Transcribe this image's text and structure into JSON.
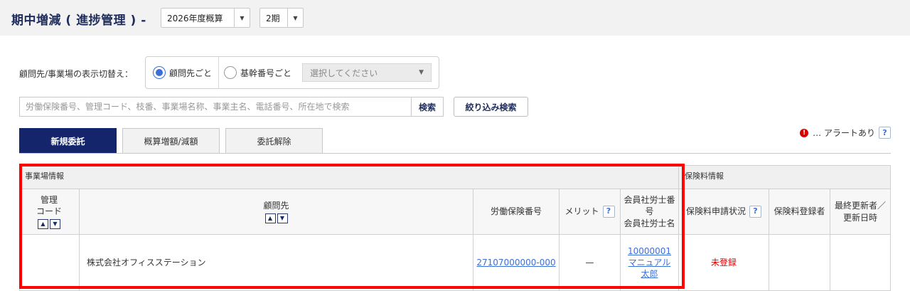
{
  "header": {
    "title": "期中増減 ( 進捗管理 ) -",
    "year_select": "2026年度概算",
    "period_select": "2期"
  },
  "switcher": {
    "label": "顧問先/事業場の表示切替え：",
    "option_client": "顧問先ごと",
    "option_base": "基幹番号ごと",
    "base_placeholder": "選択してください",
    "selected": "顧問先ごと"
  },
  "search": {
    "placeholder": "労働保険番号、管理コード、枝番、事業場名称、事業主名、電話番号、所在地で検索",
    "value": "",
    "button": "検索",
    "filter_button": "絞り込み検索"
  },
  "tabs": [
    {
      "label": "新規委託",
      "active": true
    },
    {
      "label": "概算増額/減額",
      "active": false
    },
    {
      "label": "委託解除",
      "active": false
    }
  ],
  "alert": {
    "icon": "!",
    "text": "… アラートあり",
    "help": "?"
  },
  "table": {
    "group_office": "事業場情報",
    "group_premium": "保険料情報",
    "headers": {
      "kanri_code_1": "管理",
      "kanri_code_2": "コード",
      "client": "顧問先",
      "labor_no": "労働保険番号",
      "merit": "メリット",
      "member_1": "会員社労士番",
      "member_2": "号",
      "member_3": "会員社労士名",
      "premium_status": "保険料申請状況",
      "registrant": "保険料登録者",
      "updated_1": "最終更新者／",
      "updated_2": "更新日時"
    },
    "rows": [
      {
        "kanri_code": "",
        "client": "株式会社オフィスステーション",
        "labor_no": "27107000000-000",
        "merit": "—",
        "member_no": "10000001",
        "member_name_1": "マニュアル",
        "member_name_2": "太郎",
        "premium_status": "未登録",
        "registrant": "",
        "updated": ""
      }
    ]
  },
  "colors": {
    "navy": "#14256b",
    "link": "#3a6fd8",
    "alert_red": "#e00000",
    "highlight": "#ff0000"
  }
}
